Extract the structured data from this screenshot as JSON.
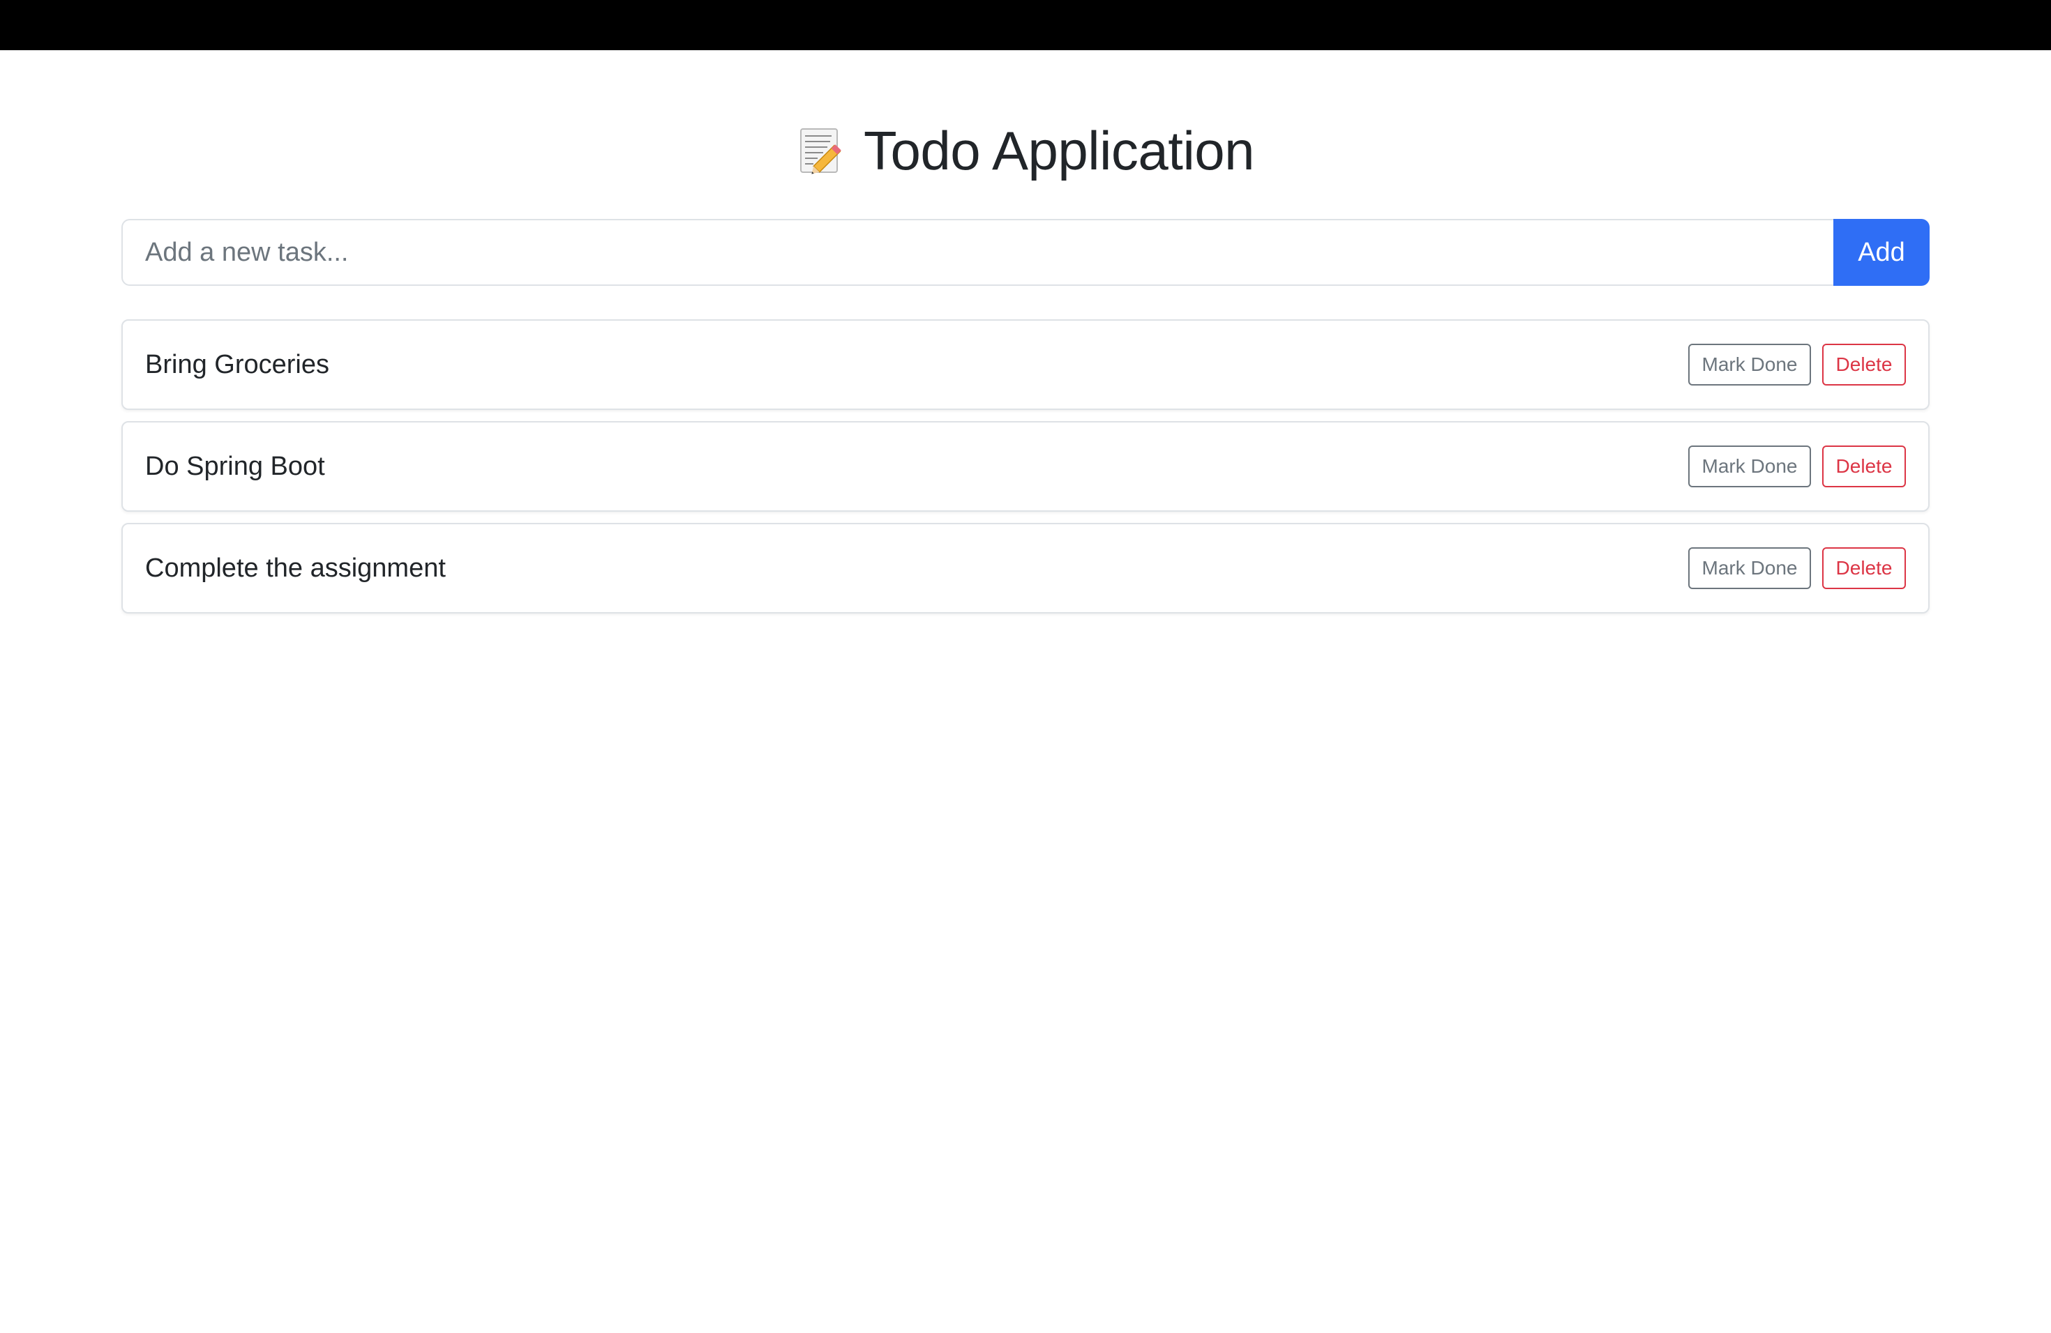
{
  "header": {
    "title": "Todo Application",
    "icon": "memo-pencil-icon"
  },
  "add_task": {
    "placeholder": "Add a new task...",
    "value": "",
    "button_label": "Add"
  },
  "tasks": [
    {
      "text": "Bring Groceries",
      "done_label": "Mark Done",
      "delete_label": "Delete"
    },
    {
      "text": "Do Spring Boot",
      "done_label": "Mark Done",
      "delete_label": "Delete"
    },
    {
      "text": "Complete the assignment",
      "done_label": "Mark Done",
      "delete_label": "Delete"
    }
  ],
  "colors": {
    "primary": "#2f6ef5",
    "secondary": "#6c757d",
    "danger": "#dc3545",
    "top_bar": "#000000"
  }
}
